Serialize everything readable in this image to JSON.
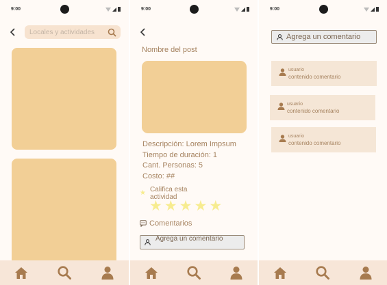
{
  "status_bar": {
    "time": "9:00"
  },
  "screen1": {
    "search_placeholder": "Locales y actividades"
  },
  "screen2": {
    "post_title": "Nombre del post",
    "details": [
      "Descripción: Lorem Impsum",
      "Tiempo de duración: 1",
      "Cant. Personas: 5",
      "Costo: ##"
    ],
    "rate_label": "Califica esta actividad",
    "rating": {
      "filled": 0,
      "max": 5
    },
    "comments_label": "Comentarios",
    "add_comment_label": "Agrega un comentario"
  },
  "screen3": {
    "add_comment_label": "Agrega un comentario",
    "comments": [
      {
        "user": "usuario",
        "content": "contenido comentario"
      },
      {
        "user": "usuario",
        "content": "contenido comentario"
      },
      {
        "user": "usuario",
        "content": "contenido comentario"
      }
    ]
  },
  "bottom_nav": {
    "items": [
      "home-icon",
      "search-icon",
      "profile-icon"
    ]
  },
  "colors": {
    "card_fill": "#f2cf96",
    "accent_brown": "#a68360",
    "icon_brown": "#a77b4f",
    "nav_background": "#f7e6d8",
    "star": "#f7ec8f"
  }
}
